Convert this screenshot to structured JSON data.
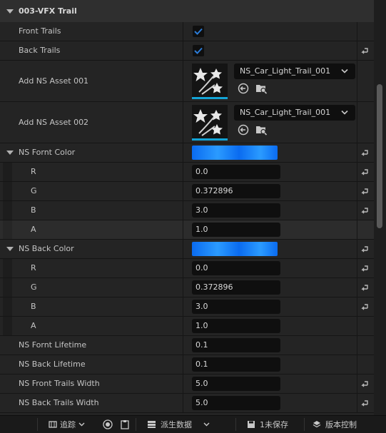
{
  "section": {
    "title": "003-VFX Trail"
  },
  "front_trails": {
    "label": "Front Trails",
    "checked": true
  },
  "back_trails": {
    "label": "Back Trails",
    "checked": true
  },
  "assets": [
    {
      "label": "Add NS Asset 001",
      "value": "NS_Car_Light_Trail_001"
    },
    {
      "label": "Add NS Asset 002",
      "value": "NS_Car_Light_Trail_001"
    }
  ],
  "front_color": {
    "label": "NS Fornt Color",
    "swatch_color": "#0a6bf0",
    "channels": [
      {
        "label": "R",
        "value": "0.0"
      },
      {
        "label": "G",
        "value": "0.372896"
      },
      {
        "label": "B",
        "value": "3.0"
      },
      {
        "label": "A",
        "value": "1.0"
      }
    ]
  },
  "back_color": {
    "label": "NS Back Color",
    "swatch_color": "#0a6bf0",
    "channels": [
      {
        "label": "R",
        "value": "0.0"
      },
      {
        "label": "G",
        "value": "0.372896"
      },
      {
        "label": "B",
        "value": "3.0"
      },
      {
        "label": "A",
        "value": "1.0"
      }
    ]
  },
  "front_lifetime": {
    "label": "NS Fornt Lifetime",
    "value": "0.1"
  },
  "back_lifetime": {
    "label": "NS Back Lifetime",
    "value": "0.1"
  },
  "front_width": {
    "label": "NS Front Trails Width",
    "value": "5.0"
  },
  "back_width": {
    "label": "NS Back Trails Width",
    "value": "5.0"
  },
  "bottom_bar": {
    "track_label": "追踪",
    "derived_label": "派生数据",
    "unsaved_label": "1未保存",
    "version_label": "版本控制"
  },
  "colors": {
    "accent": "#13a4d6",
    "checkbox": "#2b7bd6",
    "swatch": "#0a6bf0"
  }
}
